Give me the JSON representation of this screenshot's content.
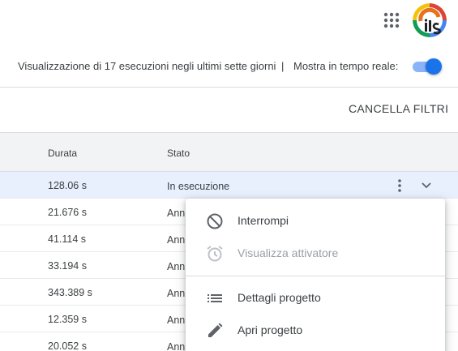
{
  "header": {
    "apps_icon": "apps-grid-icon",
    "avatar_icon": "account-avatar-icon"
  },
  "infobar": {
    "summary": "Visualizzazione di 17 esecuzioni negli ultimi sette giorni",
    "separator": "|",
    "live_label": "Mostra in tempo reale:",
    "live_enabled": true
  },
  "actions": {
    "clear_filters": "CANCELLA FILTRI"
  },
  "table": {
    "columns": {
      "duration": "Durata",
      "status": "Stato"
    },
    "rows": [
      {
        "duration": "128.06 s",
        "status": "In esecuzione",
        "selected": true
      },
      {
        "duration": "21.676 s",
        "status": "Ann"
      },
      {
        "duration": "41.114 s",
        "status": "Ann"
      },
      {
        "duration": "33.194 s",
        "status": "Ann"
      },
      {
        "duration": "343.389 s",
        "status": "Ann"
      },
      {
        "duration": "12.359 s",
        "status": "Ann"
      },
      {
        "duration": "20.052 s",
        "status": "Ann"
      }
    ]
  },
  "menu": {
    "items": [
      {
        "label": "Interrompi",
        "icon": "block-icon",
        "disabled": false
      },
      {
        "label": "Visualizza attivatore",
        "icon": "alarm-clock-icon",
        "disabled": true
      },
      {
        "label": "Dettagli progetto",
        "icon": "list-icon",
        "disabled": false
      },
      {
        "label": "Apri progetto",
        "icon": "pencil-icon",
        "disabled": false
      }
    ]
  },
  "colors": {
    "accent": "#1a73e8",
    "toggle_track": "#8ab4f8",
    "selected_row": "#e8f0fe",
    "header_bg": "#f1f3f4",
    "divider": "#dadce0",
    "text": "#3c4043",
    "disabled_text": "#9aa0a6"
  }
}
